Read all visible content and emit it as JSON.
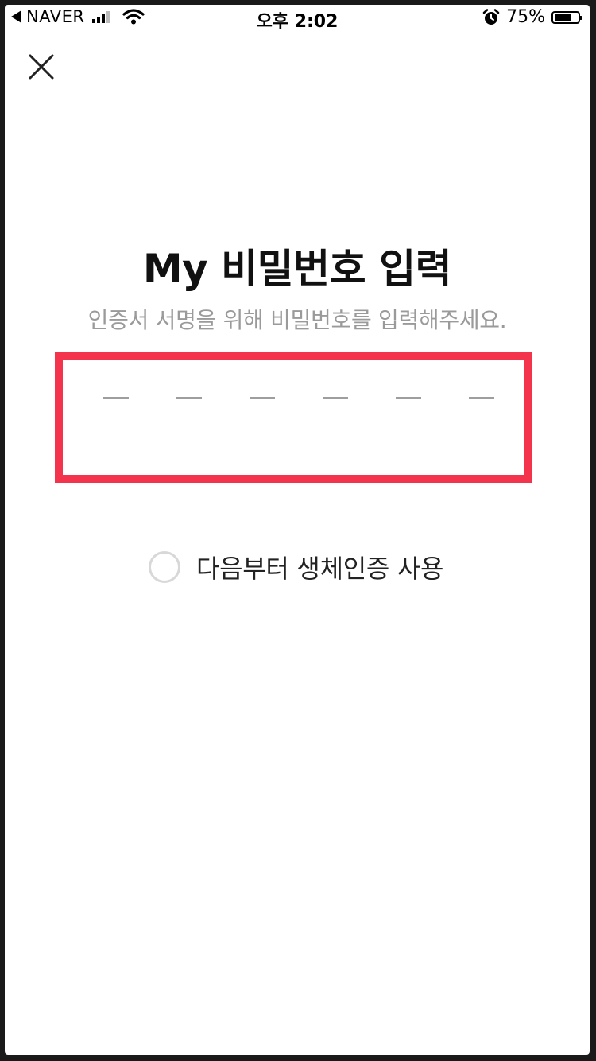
{
  "status_bar": {
    "back_app": "NAVER",
    "time": "오후 2:02",
    "battery_percent": "75%",
    "battery_level": 0.75,
    "icons": [
      "back-arrow-icon",
      "signal-icon",
      "wifi-icon",
      "alarm-icon",
      "battery-icon"
    ]
  },
  "header": {
    "close_icon": "close-icon"
  },
  "main": {
    "title": "My 비밀번호 입력",
    "subtitle": "인증서 서명을 위해 비밀번호를 입력해주세요.",
    "pin": {
      "length": 6,
      "entered": 0,
      "highlight_color": "#f4344c"
    },
    "biometric_option": {
      "label": "다음부터 생체인증 사용",
      "checked": false
    }
  }
}
